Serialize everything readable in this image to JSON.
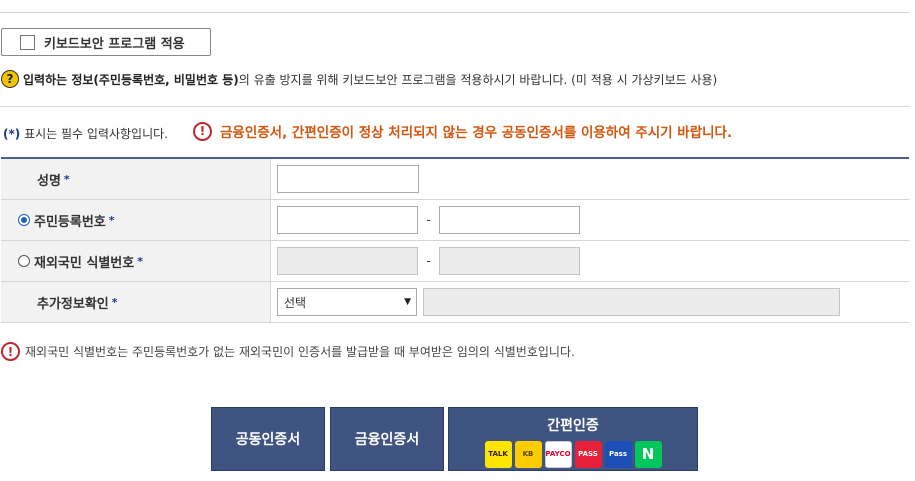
{
  "keyboard_security": {
    "label": "키보드보안 프로그램 적용"
  },
  "info_line": {
    "bold_part": "입력하는 정보(주민등록번호, 비밀번호 등)",
    "rest": "의 유출 방지를 위해 키보드보안 프로그램을 적용하시기 바랍니다. (미 적용 시 가상키보드 사용)"
  },
  "required_note": {
    "star": "(*)",
    "text": " 표시는 필수 입력사항입니다."
  },
  "warning": "금융인증서, 간편인증이 정상 처리되지 않는 경우 공동인증서를 이용하여 주시기 바랍니다.",
  "form": {
    "required_mark": "*",
    "name_label": "성명",
    "resident_label": "주민등록번호",
    "foreigner_label": "재외국민 식별번호",
    "additional_label": "추가정보확인",
    "dash": "-",
    "select_value": "선택"
  },
  "foreigner_note": "재외국민 식별번호는 주민등록번호가 없는 재외국민이 인증서를 발급받을 때 부여받은 임의의 식별번호입니다.",
  "buttons": {
    "joint": "공동인증서",
    "financial": "금융인증서",
    "simple": "간편인증"
  },
  "auth_icons": [
    {
      "name": "kakao-talk-icon",
      "text": "TALK",
      "bg": "#fee500",
      "fg": "#3a1d1d"
    },
    {
      "name": "kb-icon",
      "text": "KB",
      "bg": "#ffcc00",
      "fg": "#554400"
    },
    {
      "name": "payco-icon",
      "text": "PAYCO",
      "bg": "#ffffff",
      "fg": "#e4002b"
    },
    {
      "name": "pass-icon",
      "text": "PASS",
      "bg": "#e8203a",
      "fg": "#ffffff"
    },
    {
      "name": "samsung-pass-icon",
      "text": "Pass",
      "bg": "#1c4fb7",
      "fg": "#ffffff"
    },
    {
      "name": "naver-icon",
      "text": "N",
      "bg": "#03c75a",
      "fg": "#ffffff"
    }
  ]
}
